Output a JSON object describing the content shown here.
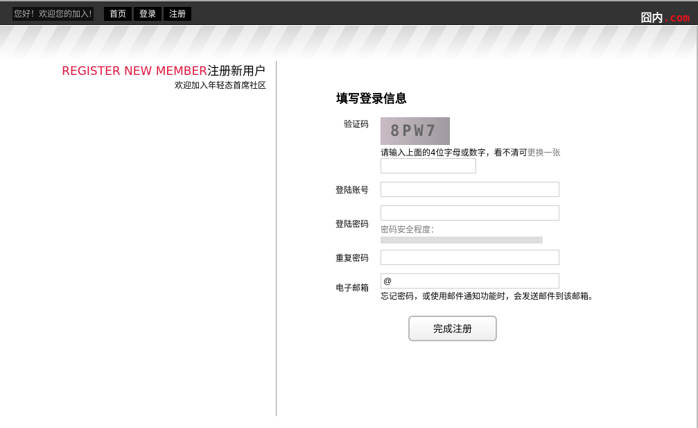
{
  "header": {
    "greeting": "您好！欢迎您的加入!",
    "nav": [
      "首页",
      "登录",
      "注册"
    ],
    "logo_main": "囧内",
    "logo_suffix": ".com"
  },
  "left": {
    "title_en": "REGISTER NEW MEMBER",
    "title_cn": "注册新用户",
    "subtitle": "欢迎加入年轻态首席社区"
  },
  "form": {
    "title": "填写登录信息",
    "captcha": {
      "label": "验证码",
      "image_text": "8PW7",
      "hint": "请输入上面的4位字母或数字，看不清可",
      "refresh_link": "更换一张",
      "value": ""
    },
    "account": {
      "label": "登陆账号",
      "value": ""
    },
    "password": {
      "label": "登陆密码",
      "value": "",
      "strength_label": "密码安全程度：",
      "strength": 0
    },
    "repeat": {
      "label": "重复密码",
      "value": ""
    },
    "email": {
      "label": "电子邮箱",
      "value": "@",
      "hint": "忘记密码，或使用邮件通知功能时，会发送邮件到该邮箱。"
    },
    "submit": "完成注册"
  }
}
